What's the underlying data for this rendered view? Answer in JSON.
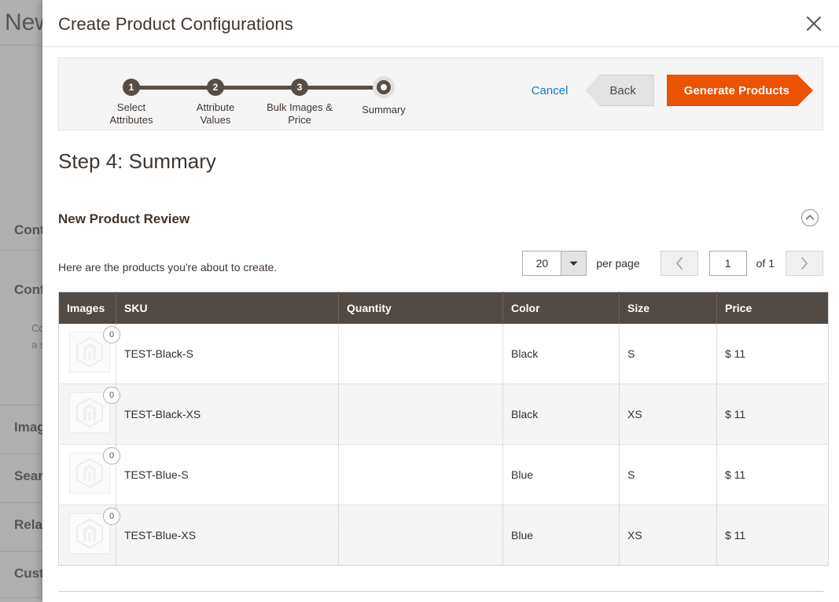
{
  "background": {
    "page_title": "New Product",
    "sections": [
      {
        "label": "Content"
      },
      {
        "label": "Configurations"
      },
      {
        "label": "Images And Videos"
      },
      {
        "label": "Search Engine Optimization"
      },
      {
        "label": "Related Products, Up-Sells, and Cross-Sells"
      },
      {
        "label": "Customizable Options"
      }
    ],
    "sub_text_line1": "Configurations describe the different variations of",
    "sub_text_line2": "a simple product."
  },
  "modal": {
    "title": "Create Product Configurations",
    "close_icon": "close-icon"
  },
  "wizard": {
    "steps": [
      {
        "number": "1",
        "label_line1": "Select",
        "label_line2": "Attributes",
        "state": "done"
      },
      {
        "number": "2",
        "label_line1": "Attribute",
        "label_line2": "Values",
        "state": "done"
      },
      {
        "number": "3",
        "label_line1": "Bulk Images &",
        "label_line2": "Price",
        "state": "done"
      },
      {
        "number": "4",
        "label_line1": "Summary",
        "label_line2": "",
        "state": "current"
      }
    ],
    "cancel_label": "Cancel",
    "back_label": "Back",
    "generate_label": "Generate Products",
    "accent_color": "#eb5202",
    "link_color": "#1979c3",
    "step_color": "#564d47"
  },
  "step_heading": "Step 4: Summary",
  "section": {
    "title": "New Product Review",
    "collapse_icon": "chevron-up-circle-icon",
    "note": "Here are the products you're about to create."
  },
  "pagination": {
    "per_page_value": "20",
    "per_page_label": "per page",
    "page_value": "1",
    "page_total": "of 1",
    "prev_icon": "chevron-left-icon",
    "next_icon": "chevron-right-icon",
    "dropdown_icon": "chevron-down-icon"
  },
  "grid": {
    "columns": [
      "Images",
      "SKU",
      "Quantity",
      "Color",
      "Size",
      "Price"
    ],
    "rows": [
      {
        "image_badge": "0",
        "sku": "TEST-Black-S",
        "quantity": "",
        "color": "Black",
        "size": "S",
        "price": "$ 11"
      },
      {
        "image_badge": "0",
        "sku": "TEST-Black-XS",
        "quantity": "",
        "color": "Black",
        "size": "XS",
        "price": "$ 11"
      },
      {
        "image_badge": "0",
        "sku": "TEST-Blue-S",
        "quantity": "",
        "color": "Blue",
        "size": "S",
        "price": "$ 11"
      },
      {
        "image_badge": "0",
        "sku": "TEST-Blue-XS",
        "quantity": "",
        "color": "Blue",
        "size": "XS",
        "price": "$ 11"
      }
    ],
    "header_bg": "#514943"
  }
}
